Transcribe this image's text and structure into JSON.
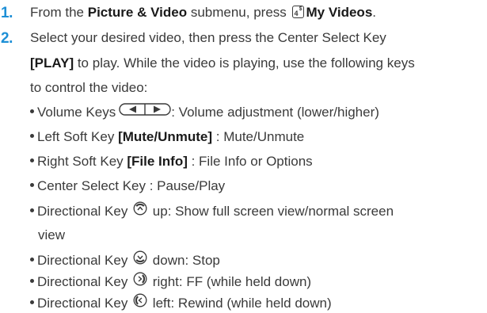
{
  "step1": {
    "number": "1.",
    "text_before": "From the ",
    "submenu_name": "Picture & Video",
    "text_middle": " submenu, press ",
    "key_icon": "key-4-icon",
    "key_number": "4",
    "key_symbol": "$",
    "target_name": "My Videos",
    "text_end": "."
  },
  "step2": {
    "number": "2.",
    "line1": "Select your desired video, then press the Center Select Key",
    "play_label": "[PLAY]",
    "line2_rest": " to play. While the video is playing, use the following keys",
    "line3": "to control the video:"
  },
  "bullets": [
    {
      "prefix": "Volume Keys",
      "icon": "volume-keys-icon",
      "suffix": ": Volume adjustment (lower/higher)"
    },
    {
      "prefix": "Left Soft Key ",
      "bold": "[Mute/Unmute]",
      "suffix": " : Mute/Unmute"
    },
    {
      "prefix": "Right Soft Key ",
      "bold": "[File Info]",
      "suffix": " : File Info or Options"
    },
    {
      "prefix": "Center Select Key : Pause/Play"
    },
    {
      "prefix": "Directional Key",
      "icon": "directional-up-icon",
      "suffix": "up: Show full screen view/normal screen",
      "continuation": "view"
    },
    {
      "prefix": "Directional Key",
      "icon": "directional-down-icon",
      "suffix": "down: Stop"
    },
    {
      "prefix": "Directional Key",
      "icon": "directional-right-icon",
      "suffix": "right: FF (while held down)"
    },
    {
      "prefix": "Directional Key",
      "icon": "directional-left-icon",
      "suffix": "left: Rewind (while held down)"
    }
  ]
}
